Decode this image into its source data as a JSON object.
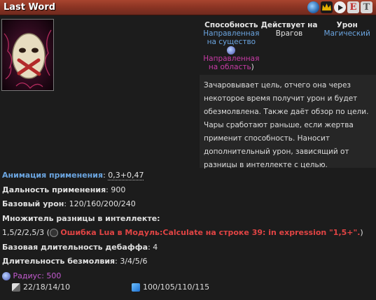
{
  "title": "Last Word",
  "header_icons": [
    "intelligence-icon",
    "crown-icon",
    "play-icon",
    "e-icon",
    "t-icon"
  ],
  "header_letters": {
    "e": "E",
    "t": "T"
  },
  "table": {
    "ability_head": "Способность",
    "ability_val1": "Направленная на существо",
    "ability_val2": "Направленная на область",
    "ability_paren_close": ")",
    "affects_head": "Действует на",
    "affects_val": "Врагов",
    "damage_head": "Урон",
    "damage_val": "Магический"
  },
  "description": "Зачаровывает цель, отчего она через некоторое время получит урон и будет обезмолвлена. Также даёт обзор по цели. Чары сработают раньше, если жертва применит способность. Наносит дополнительный урон, зависящий от разницы в интеллекте с целью.",
  "details": {
    "anim_label": "Анимация применения",
    "anim_value": "0,3+0,47",
    "range_label": "Дальность применения",
    "range_value": "900",
    "base_dmg_label": "Базовый урон",
    "base_dmg_value": "120/160/200/240",
    "int_mult_label": "Множитель разницы в интеллекте:",
    "int_mult_value": "1,5/2/2,5/3",
    "error_text": "Ошибка Lua в Модуль:Calculate на строке 39: in expression \"1,5+\".",
    "debuff_label": "Базовая длительность дебаффа",
    "debuff_value": "4",
    "silence_label": "Длительность безмолвия",
    "silence_value": "3/4/5/6",
    "radius_label": "Радиус",
    "radius_value": "500"
  },
  "cooldown": "22/18/14/10",
  "mana": "100/105/110/115",
  "colors": {
    "header": "#8d3524",
    "blue": "#6ba5e0",
    "error": "#e14444",
    "radius": "#c45bd0"
  }
}
